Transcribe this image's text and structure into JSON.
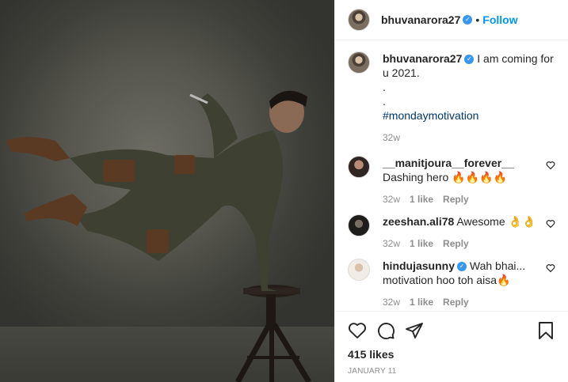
{
  "post": {
    "author": "bhuvanarora27",
    "follow_label": "Follow",
    "dot": "•",
    "caption_line1": "I am coming for u 2021.",
    "caption_dot1": ".",
    "caption_dot2": ".",
    "hashtag": "#mondaymotivation",
    "caption_age": "32w",
    "likes": "415 likes",
    "date": "January 11"
  },
  "comments": [
    {
      "user": "__manitjoura__forever__",
      "text": "Dashing hero 🔥🔥🔥🔥",
      "age": "32w",
      "likes": "1 like",
      "reply": "Reply"
    },
    {
      "user": "zeeshan.ali78",
      "text": "Awesome 👌👌",
      "age": "32w",
      "likes": "1 like",
      "reply": "Reply"
    },
    {
      "user": "hindujasunny",
      "text": "Wah bhai... motivation hoo toh aisa🔥",
      "age": "32w",
      "likes": "1 like",
      "reply": "Reply",
      "verified": true
    }
  ],
  "icons": {
    "like": "heart-icon",
    "comment": "comment-icon",
    "share": "share-icon",
    "save": "bookmark-icon",
    "verified": "verified-badge-icon"
  },
  "colors": {
    "accent": "#0095f6",
    "verified": "#3897f0",
    "muted": "#8e8e8e",
    "text": "#262626"
  }
}
